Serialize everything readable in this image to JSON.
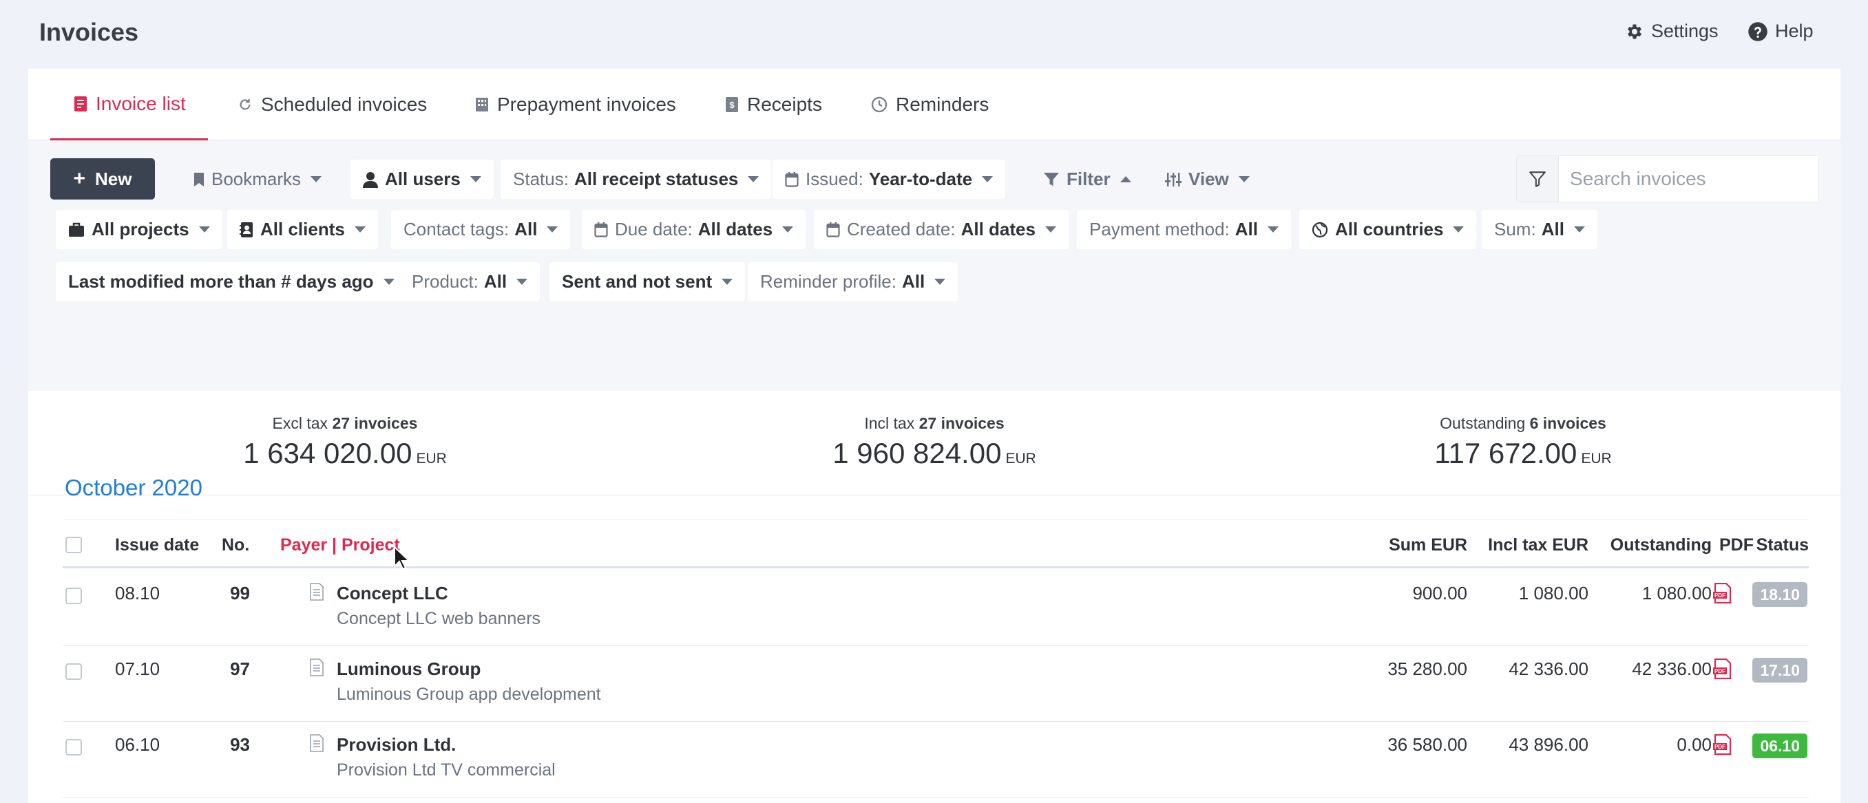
{
  "header": {
    "title": "Invoices",
    "settings_label": "Settings",
    "help_label": "Help"
  },
  "tabs": [
    {
      "label": "Invoice list",
      "icon": "invoice-icon",
      "active": true
    },
    {
      "label": "Scheduled invoices",
      "icon": "refresh-icon",
      "active": false
    },
    {
      "label": "Prepayment invoices",
      "icon": "building-icon",
      "active": false
    },
    {
      "label": "Receipts",
      "icon": "receipt-icon",
      "active": false
    },
    {
      "label": "Reminders",
      "icon": "clock-icon",
      "active": false
    }
  ],
  "toolbar": {
    "new_label": "New",
    "bookmarks_label": "Bookmarks",
    "users_value": "All users",
    "status_label": "Status:",
    "status_value": "All receipt statuses",
    "issued_label": "Issued:",
    "issued_value": "Year-to-date",
    "filter_label": "Filter",
    "view_label": "View",
    "search_placeholder": "Search invoices"
  },
  "filters_row1": {
    "projects_value": "All projects",
    "clients_value": "All clients",
    "contact_tags_label": "Contact tags:",
    "contact_tags_value": "All",
    "due_date_label": "Due date:",
    "due_date_value": "All dates",
    "created_date_label": "Created date:",
    "created_date_value": "All dates",
    "payment_method_label": "Payment method:",
    "payment_method_value": "All",
    "countries_value": "All countries",
    "sum_label": "Sum:",
    "sum_value": "All"
  },
  "filters_row2": {
    "last_modified_value": "Last modified more than # days ago",
    "product_label": "Product:",
    "product_value": "All",
    "sent_value": "Sent and not sent",
    "reminder_profile_label": "Reminder profile:",
    "reminder_profile_value": "All"
  },
  "summary": [
    {
      "label": "Excl tax",
      "count": "27 invoices",
      "value": "1 634 020.00",
      "currency": "EUR"
    },
    {
      "label": "Incl tax",
      "count": "27 invoices",
      "value": "1 960 824.00",
      "currency": "EUR"
    },
    {
      "label": "Outstanding",
      "count": "6 invoices",
      "value": "117 672.00",
      "currency": "EUR"
    }
  ],
  "month_heading": "October 2020",
  "table": {
    "columns": {
      "issue_date": "Issue date",
      "no": "No.",
      "payer_project": "Payer | Project",
      "sum": "Sum EUR",
      "incl_tax": "Incl tax EUR",
      "outstanding": "Outstanding",
      "pdf": "PDF",
      "status": "Status"
    },
    "rows": [
      {
        "issue_date": "08.10",
        "no": "99",
        "payer": "Concept LLC",
        "project": "Concept LLC web banners",
        "sum": "900.00",
        "incl_tax": "1 080.00",
        "outstanding": "1 080.00",
        "status": "18.10",
        "status_color": "#b3b9c2"
      },
      {
        "issue_date": "07.10",
        "no": "97",
        "payer": "Luminous Group",
        "project": "Luminous Group app development",
        "sum": "35 280.00",
        "incl_tax": "42 336.00",
        "outstanding": "42 336.00",
        "status": "17.10",
        "status_color": "#b3b9c2"
      },
      {
        "issue_date": "06.10",
        "no": "93",
        "payer": "Provision Ltd.",
        "project": "Provision Ltd TV commercial",
        "sum": "36 580.00",
        "incl_tax": "43 896.00",
        "outstanding": "0.00",
        "status": "06.10",
        "status_color": "#3dba3d"
      }
    ]
  },
  "colors": {
    "accent": "#de2a4e",
    "month_link": "#1f7fd6",
    "new_button": "#3c4350",
    "status_pending": "#b3b9c2",
    "status_paid": "#3dba3d"
  }
}
